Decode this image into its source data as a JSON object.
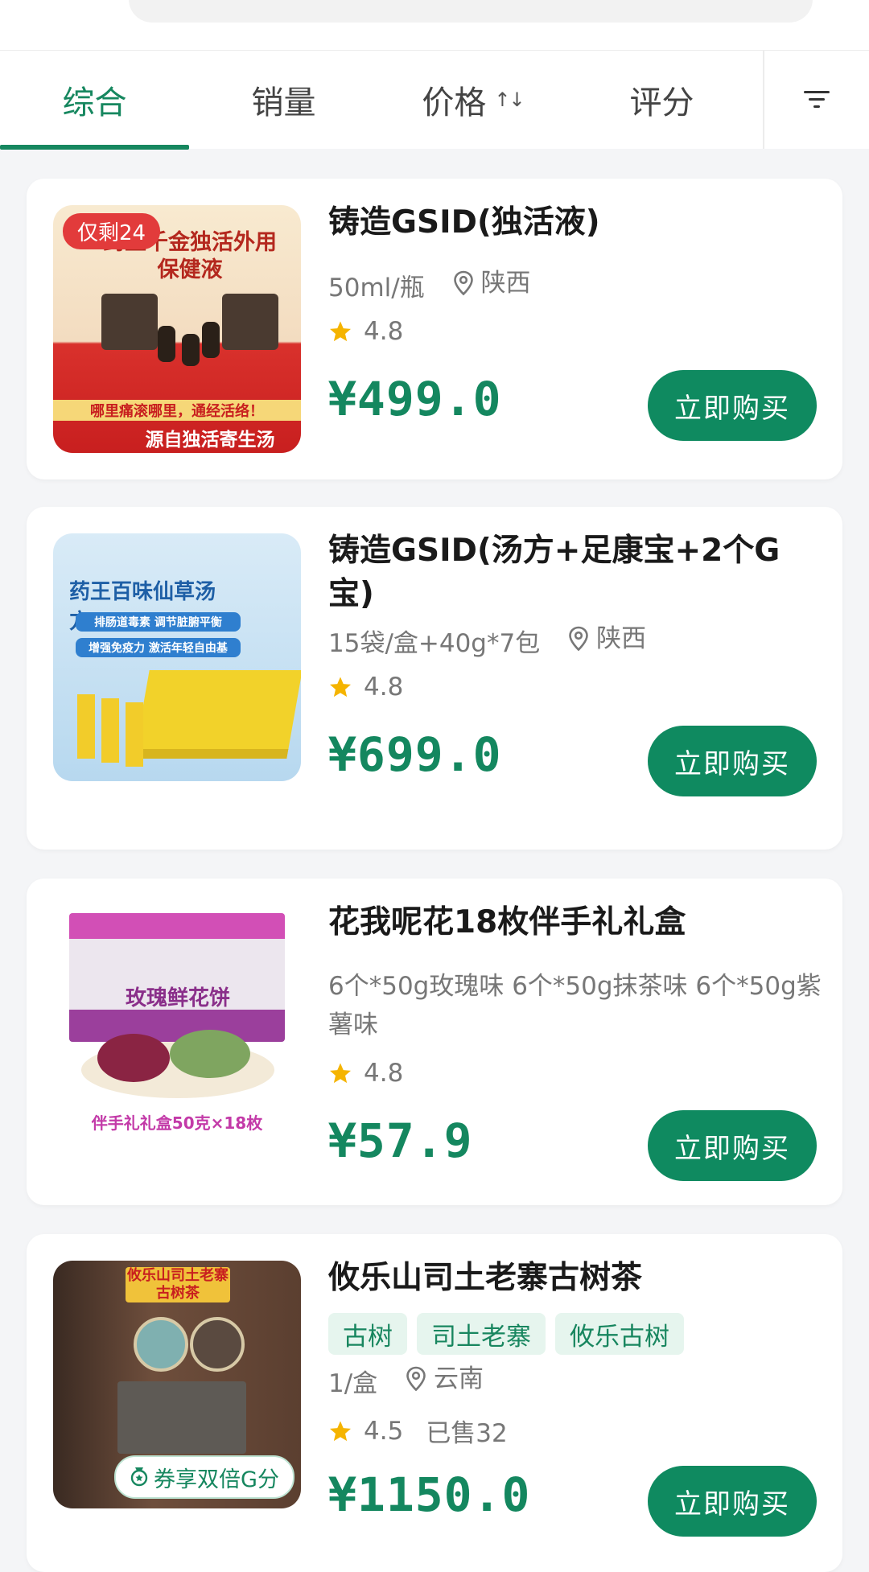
{
  "sort_tabs": [
    {
      "label": "综合",
      "active": true
    },
    {
      "label": "销量",
      "active": false
    },
    {
      "label": "价格",
      "active": false,
      "sort_icon": "sort-arrows-icon",
      "sort_glyph": "↑↓"
    },
    {
      "label": "评分",
      "active": false
    }
  ],
  "filter_icon": "filter-icon",
  "products": [
    {
      "title": "铸造GSID(独活液)",
      "spec": "50ml/瓶",
      "location": "陕西",
      "rating": "4.8",
      "price": "¥499.0",
      "buy_label": "立即购买",
      "badge": "仅剩24",
      "image_text": [
        "药王千金独活外用",
        "保健液",
        "哪里痛滚哪里，通经活络！",
        "源自独活寄生汤"
      ]
    },
    {
      "title": "铸造GSID(汤方+足康宝+2个G宝)",
      "spec": "15袋/盒+40g*7包",
      "location": "陕西",
      "rating": "4.8",
      "price": "¥699.0",
      "buy_label": "立即购买",
      "image_text": [
        "药王百味仙草汤方",
        "排肠道毒素 调节脏腑平衡",
        "增强免疫力 激活年轻自由基"
      ]
    },
    {
      "title": "花我呢花18枚伴手礼礼盒",
      "spec": "6个*50g玫瑰味  6个*50g抹茶味  6个*50g紫薯味",
      "rating": "4.8",
      "price": "¥57.9",
      "buy_label": "立即购买",
      "image_text": [
        "玫瑰鲜花饼",
        "伴手礼礼盒50克×18枚"
      ]
    },
    {
      "title": "攸乐山司土老寨古树茶",
      "tags": [
        "古树",
        "司土老寨",
        "攸乐古树"
      ],
      "spec": "1/盒",
      "location": "云南",
      "rating": "4.5",
      "sold": "已售32",
      "price": "¥1150.0",
      "buy_label": "立即购买",
      "coupon": "券享双倍G分",
      "image_text": [
        "攸乐山司土老寨",
        "古树茶"
      ]
    }
  ],
  "colors": {
    "accent": "#16875f",
    "button": "#0f8a60",
    "badge": "#e23b3b",
    "star": "#f5b400"
  }
}
